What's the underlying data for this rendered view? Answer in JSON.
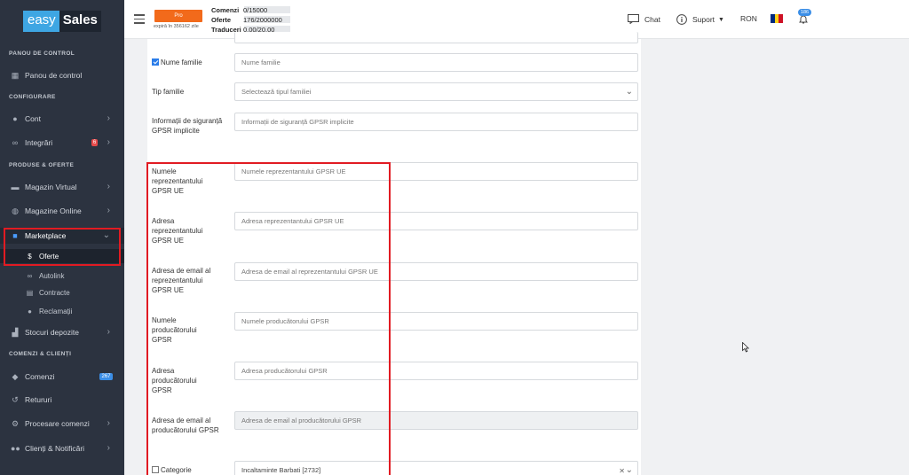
{
  "brand": {
    "easy": "easy",
    "sales": "Sales"
  },
  "sidebar": {
    "sections": {
      "panou": "PANOU DE CONTROL",
      "config": "CONFIGURARE",
      "produse": "PRODUSE & OFERTE",
      "comenzi": "COMENZI & CLIENȚI"
    },
    "items": {
      "panou": "Panou de control",
      "cont": "Cont",
      "integrari": "Integrări",
      "integrari_badge": "6",
      "magazin_virtual": "Magazin Virtual",
      "magazine_online": "Magazine Online",
      "marketplace": "Marketplace",
      "oferte": "Oferte",
      "autolink": "Autolink",
      "contracte": "Contracte",
      "reclamatii": "Reclamații",
      "stocuri": "Stocuri depozite",
      "comenzi": "Comenzi",
      "comenzi_badge": "267",
      "retururi": "Retururi",
      "procesare": "Procesare comenzi",
      "clienti": "Clienți & Notificări"
    }
  },
  "topbar": {
    "plan_label": "Pro",
    "expires": "expiră în 356162 zile",
    "stats": [
      {
        "label": "Comenzi",
        "value": "0/15000"
      },
      {
        "label": "Oferte",
        "value": "176/2000000"
      },
      {
        "label": "Traduceri",
        "value": "0.00/20.00"
      }
    ],
    "chat": "Chat",
    "suport": "Suport",
    "currency": "RON",
    "notif_count": "186"
  },
  "form": {
    "nume_familie": {
      "label": "Nume familie",
      "placeholder": "Nume familie"
    },
    "tip_familie": {
      "label": "Tip familie",
      "value": "Selectează tipul familiei"
    },
    "info_gpsr": {
      "label": "Informații de siguranță GPSR implicite",
      "placeholder": "Informații de siguranță GPSR implicite"
    },
    "nume_repr": {
      "label": "Numele reprezentantului GPSR UE",
      "placeholder": "Numele reprezentantului GPSR UE"
    },
    "adresa_repr": {
      "label": "Adresa reprezentantului GPSR UE",
      "placeholder": "Adresa reprezentantului GPSR UE"
    },
    "email_repr": {
      "label": "Adresa de email al reprezentantului GPSR UE",
      "placeholder": "Adresa de email al reprezentantului GPSR UE"
    },
    "nume_prod": {
      "label": "Numele producătorului GPSR",
      "placeholder": "Numele producătorului GPSR"
    },
    "adresa_prod": {
      "label": "Adresa producătorului GPSR",
      "placeholder": "Adresa producătorului GPSR"
    },
    "email_prod": {
      "label": "Adresa de email al producătorului GPSR",
      "placeholder": "Adresa de email al producătorului GPSR"
    },
    "categorie": {
      "label": "Categorie",
      "value": "Incaltaminte Barbati [2732]"
    }
  }
}
